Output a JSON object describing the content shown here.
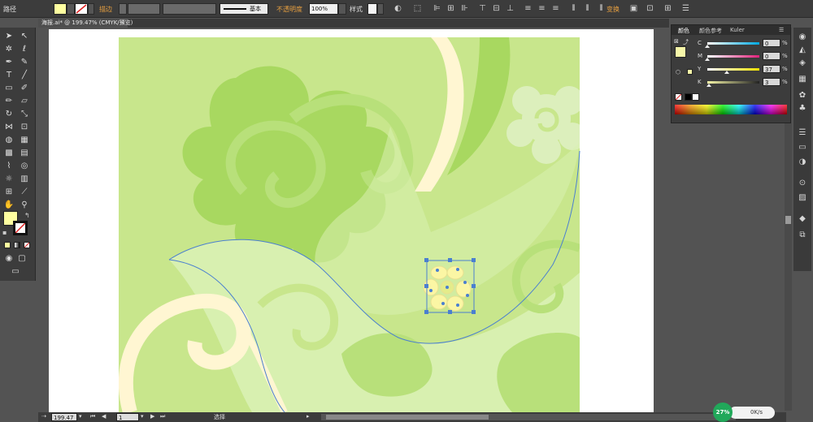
{
  "control_bar": {
    "mode_label": "路径",
    "stroke_label": "描边",
    "stroke_style": "基本",
    "opacity_label": "不透明度",
    "opacity_value": "100%",
    "style_label": "样式",
    "transform_label": "变换",
    "fill_color": "#ffffa0"
  },
  "document_tab": {
    "label": "海报.ai* @ 199.47% (CMYK/预览)"
  },
  "color_panel": {
    "tabs": [
      "颜色",
      "颜色参考",
      "Kuler"
    ],
    "channels": [
      {
        "name": "C",
        "value": "0",
        "level": 0
      },
      {
        "name": "M",
        "value": "0",
        "level": 0
      },
      {
        "name": "Y",
        "value": "37",
        "level": 37
      },
      {
        "name": "K",
        "value": "3",
        "level": 3
      }
    ],
    "percent_sign": "%",
    "current_color": "#f6f6a8"
  },
  "tools": {
    "fill_color": "#ffffa0"
  },
  "status_bar": {
    "zoom": "199.47",
    "artboard_number": "1",
    "tool_name": "选择"
  },
  "net_widget": {
    "percent": "27%",
    "speed": "0K/s"
  },
  "artwork": {
    "background": "#c8e68c",
    "dark_green": "#a8d860",
    "mid_green": "#b8e07a",
    "light_green": "#d8f0b0",
    "cream": "#fff6d2",
    "flower_fill": "#fbf6a4",
    "selection_color": "#4a7fd0"
  }
}
